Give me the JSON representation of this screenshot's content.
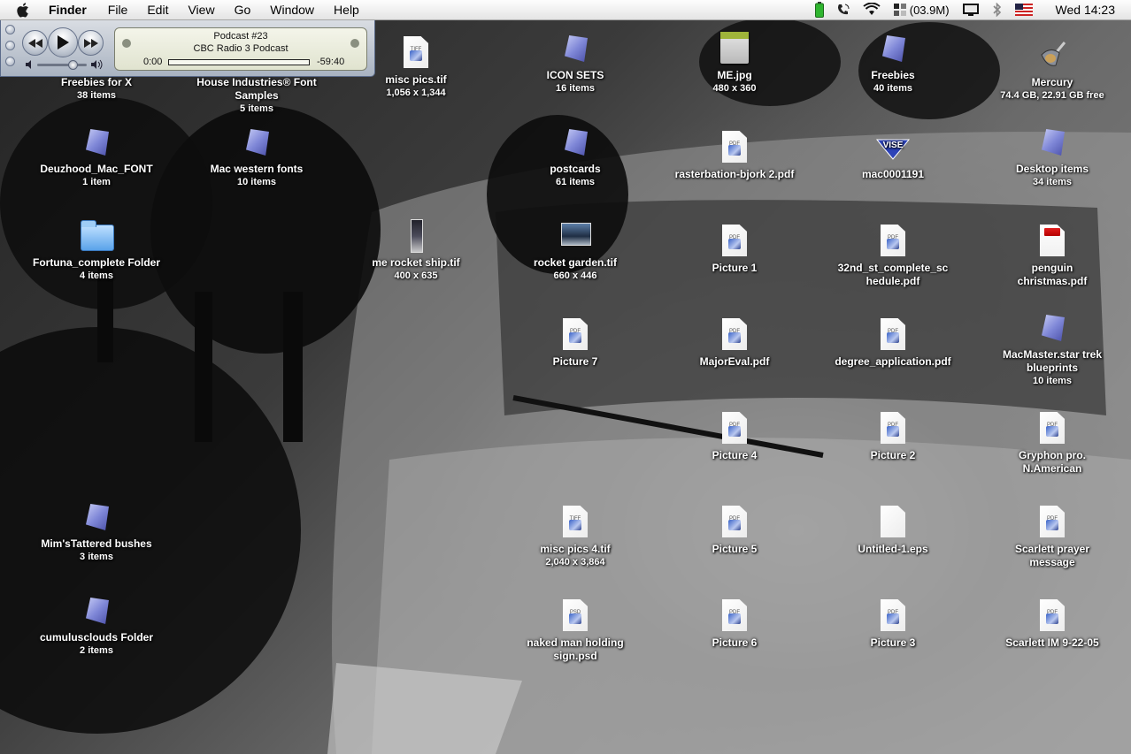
{
  "menubar": {
    "app_name": "Finder",
    "menus": [
      "File",
      "Edit",
      "View",
      "Go",
      "Window",
      "Help"
    ],
    "memory": "(03.9M)",
    "clock": "Wed 14:23"
  },
  "mini_player": {
    "title": "Podcast #23",
    "subtitle": "CBC Radio 3 Podcast",
    "elapsed": "0:00",
    "remaining": "-59:40",
    "progress": 0.0,
    "volume": 0.75
  },
  "desktop": {
    "icons": [
      {
        "id": "freebies-x",
        "name": "Freebies for X",
        "sub": "38 items",
        "kind": "shard"
      },
      {
        "id": "house-industries",
        "name": "House Industries® Font Samples",
        "sub": "5 items",
        "kind": "shard"
      },
      {
        "id": "misc-pics",
        "name": "misc pics.tif",
        "sub": "1,056 x 1,344",
        "kind": "doc",
        "tag": "TIFF"
      },
      {
        "id": "icon-sets",
        "name": "ICON SETS",
        "sub": "16 items",
        "kind": "shard"
      },
      {
        "id": "me-jpg",
        "name": "ME.jpg",
        "sub": "480 x 360",
        "kind": "jpg"
      },
      {
        "id": "freebies",
        "name": "Freebies",
        "sub": "40 items",
        "kind": "shard"
      },
      {
        "id": "mercury",
        "name": "Mercury",
        "sub": "74.4 GB, 22.91 GB free",
        "kind": "mercury"
      },
      {
        "id": "deuzhood",
        "name": "Deuzhood_Mac_FONT",
        "sub": "1 item",
        "kind": "shard"
      },
      {
        "id": "mac-western",
        "name": "Mac western fonts",
        "sub": "10 items",
        "kind": "shard"
      },
      {
        "id": "postcards",
        "name": "postcards",
        "sub": "61 items",
        "kind": "shard"
      },
      {
        "id": "rasterbation",
        "name": "rasterbation-bjork 2.pdf",
        "sub": "",
        "kind": "doc",
        "tag": "PDF"
      },
      {
        "id": "mac0001191",
        "name": "mac0001191",
        "sub": "",
        "kind": "vise"
      },
      {
        "id": "desktop-items",
        "name": "Desktop items",
        "sub": "34 items",
        "kind": "shard"
      },
      {
        "id": "fortuna",
        "name": "Fortuna_complete Folder",
        "sub": "4 items",
        "kind": "folder"
      },
      {
        "id": "me-rocket",
        "name": "me rocket ship.tif",
        "sub": "400 x 635",
        "kind": "thumb-tall"
      },
      {
        "id": "rocket-garden",
        "name": "rocket garden.tif",
        "sub": "660 x 446",
        "kind": "thumb"
      },
      {
        "id": "picture-1",
        "name": "Picture 1",
        "sub": "",
        "kind": "doc",
        "tag": "PDF"
      },
      {
        "id": "32nd-st",
        "name": "32nd_st_complete_schedule.pdf",
        "sub": "",
        "kind": "doc",
        "tag": "PDF"
      },
      {
        "id": "penguin",
        "name": "penguin christmas.pdf",
        "sub": "",
        "kind": "doc-red",
        "tag": "PDF"
      },
      {
        "id": "picture-7",
        "name": "Picture 7",
        "sub": "",
        "kind": "doc",
        "tag": "PDF"
      },
      {
        "id": "majoreval",
        "name": "MajorEval.pdf",
        "sub": "",
        "kind": "doc",
        "tag": "PDF"
      },
      {
        "id": "degree-app",
        "name": "degree_application.pdf",
        "sub": "",
        "kind": "doc",
        "tag": "PDF"
      },
      {
        "id": "macmaster",
        "name": "MacMaster.star trek blueprints",
        "sub": "10 items",
        "kind": "shard"
      },
      {
        "id": "picture-4",
        "name": "Picture 4",
        "sub": "",
        "kind": "doc",
        "tag": "PDF"
      },
      {
        "id": "picture-2",
        "name": "Picture 2",
        "sub": "",
        "kind": "doc",
        "tag": "PDF"
      },
      {
        "id": "gryphon",
        "name": "Gryphon pro. N.American",
        "sub": "",
        "kind": "doc",
        "tag": "PDF"
      },
      {
        "id": "mims-tattered",
        "name": "Mim'sTattered bushes",
        "sub": "3 items",
        "kind": "shard"
      },
      {
        "id": "misc-pics-4",
        "name": "misc pics 4.tif",
        "sub": "2,040 x 3,864",
        "kind": "doc",
        "tag": "TIFF"
      },
      {
        "id": "picture-5",
        "name": "Picture 5",
        "sub": "",
        "kind": "doc",
        "tag": "PDF"
      },
      {
        "id": "untitled-eps",
        "name": "Untitled-1.eps",
        "sub": "",
        "kind": "doc-blank",
        "tag": ""
      },
      {
        "id": "scarlett-prayer",
        "name": "Scarlett prayer message",
        "sub": "",
        "kind": "doc",
        "tag": "PDF"
      },
      {
        "id": "cumulusclouds",
        "name": "cumulusclouds Folder",
        "sub": "2 items",
        "kind": "shard"
      },
      {
        "id": "naked-man",
        "name": "naked man holding sign.psd",
        "sub": "",
        "kind": "doc",
        "tag": "PSD"
      },
      {
        "id": "picture-6",
        "name": "Picture 6",
        "sub": "",
        "kind": "doc",
        "tag": "PDF"
      },
      {
        "id": "picture-3",
        "name": "Picture 3",
        "sub": "",
        "kind": "doc",
        "tag": "PDF"
      },
      {
        "id": "scarlett-im",
        "name": "Scarlett IM 9-22-05",
        "sub": "",
        "kind": "doc",
        "tag": "PDF"
      }
    ]
  }
}
